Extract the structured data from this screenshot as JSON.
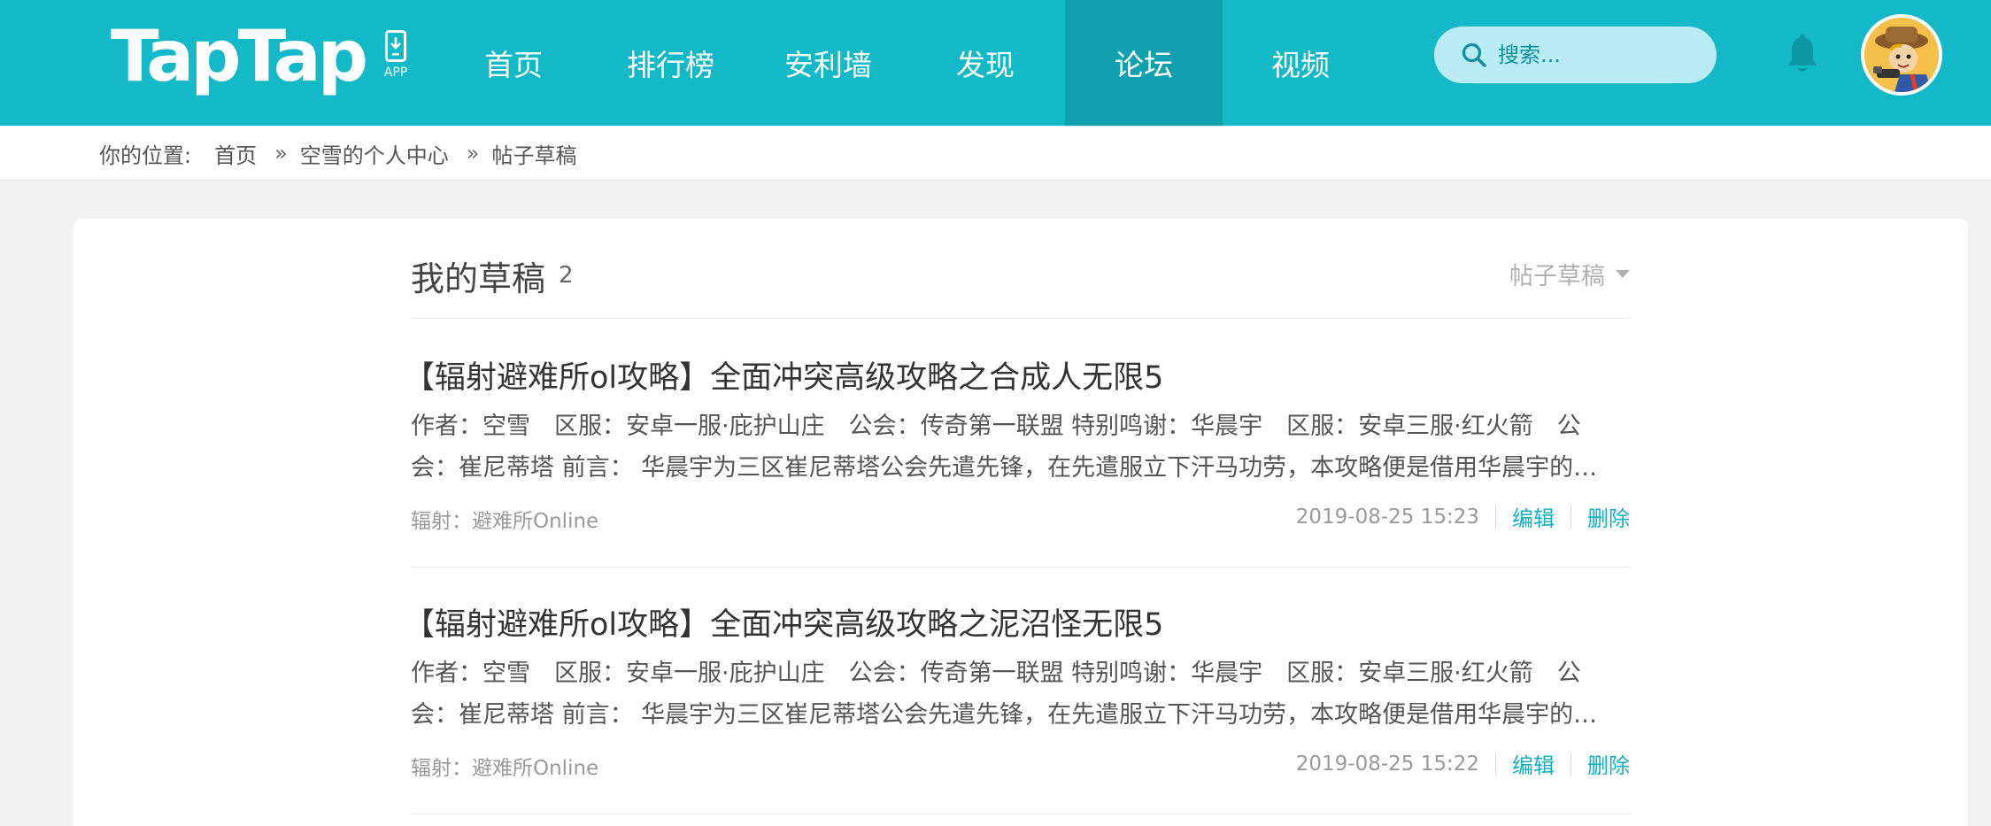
{
  "header": {
    "logo_text": "TapTap",
    "app_label": "APP",
    "nav": [
      "首页",
      "排行榜",
      "安利墙",
      "发现",
      "论坛",
      "视频"
    ],
    "active_nav": "论坛",
    "search_placeholder": "搜索...",
    "colors": {
      "brand": "#14b9c8",
      "active_tab": "#11a1ae",
      "search_bg": "#b8ebf3"
    }
  },
  "breadcrumb": {
    "label": "你的位置:",
    "items": [
      "首页",
      "空雪的个人中心",
      "帖子草稿"
    ],
    "separator": "»"
  },
  "main": {
    "title": "我的草稿",
    "count": "2",
    "filter_label": "帖子草稿",
    "posts": [
      {
        "title": "【辐射避难所ol攻略】全面冲突高级攻略之合成人无限5",
        "excerpt": "作者：空雪　区服：安卓一服·庇护山庄　公会：传奇第一联盟 特别鸣谢：华晨宇　区服：安卓三服·红火箭　公会：崔尼蒂塔 前言：  华晨宇为三区崔尼蒂塔公会先遣先锋，在先遣服立下汗马功劳，本攻略便是借用华晨宇的阵容",
        "game": "辐射：避难所Online",
        "time": "2019-08-25 15:23",
        "edit_label": "编辑",
        "delete_label": "删除"
      },
      {
        "title": "【辐射避难所ol攻略】全面冲突高级攻略之泥沼怪无限5",
        "excerpt": "作者：空雪　区服：安卓一服·庇护山庄　公会：传奇第一联盟 特别鸣谢：华晨宇　区服：安卓三服·红火箭　公会：崔尼蒂塔 前言：  华晨宇为三区崔尼蒂塔公会先遣先锋，在先遣服立下汗马功劳，本攻略便是借用华晨宇的阵容",
        "game": "辐射：避难所Online",
        "time": "2019-08-25 15:22",
        "edit_label": "编辑",
        "delete_label": "删除"
      }
    ],
    "colors": {
      "link": "#14b0c0"
    }
  }
}
